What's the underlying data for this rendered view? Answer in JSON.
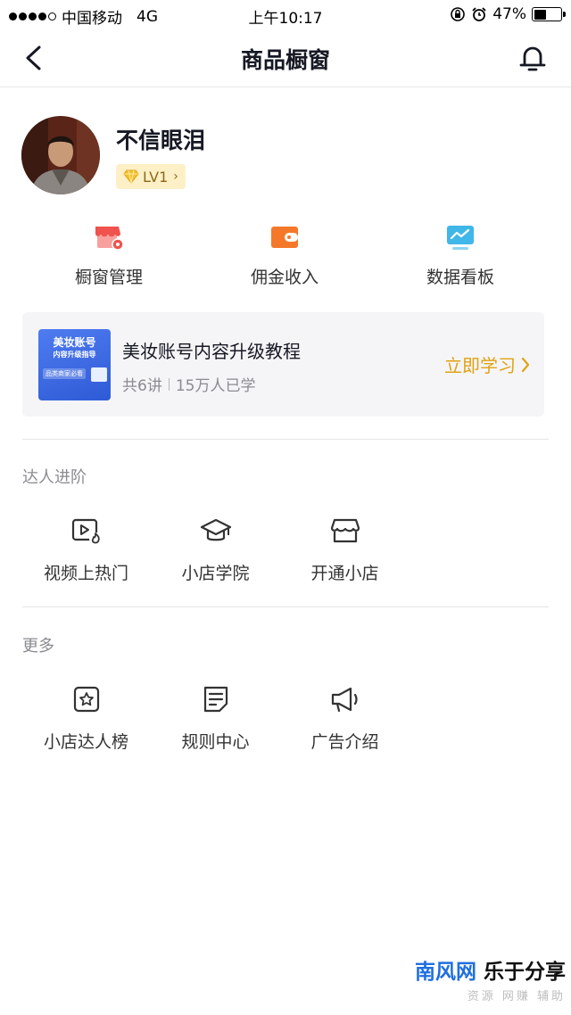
{
  "status_bar": {
    "carrier": "中国移动",
    "network": "4G",
    "time": "上午10:17",
    "battery": "47%",
    "battery_level": 0.47
  },
  "nav": {
    "title": "商品橱窗"
  },
  "profile": {
    "name": "不信眼泪",
    "level": "LV1"
  },
  "quick_actions": [
    {
      "label": "橱窗管理",
      "icon": "storefront-gear-icon",
      "color": "#f0524d"
    },
    {
      "label": "佣金收入",
      "icon": "wallet-icon",
      "color": "#f5782a"
    },
    {
      "label": "数据看板",
      "icon": "dashboard-screen-icon",
      "color": "#3fb7e8"
    }
  ],
  "course": {
    "thumb_title": "美妆账号",
    "thumb_subtitle": "内容升级指导",
    "thumb_tag": "品类商家必看",
    "title": "美妆账号内容升级教程",
    "lessons": "共6讲",
    "learners": "15万人已学",
    "cta": "立即学习"
  },
  "sections": [
    {
      "title": "达人进阶",
      "items": [
        {
          "label": "视频上热门",
          "icon": "video-hot-icon"
        },
        {
          "label": "小店学院",
          "icon": "graduation-cap-icon"
        },
        {
          "label": "开通小店",
          "icon": "shop-icon"
        }
      ]
    },
    {
      "title": "更多",
      "items": [
        {
          "label": "小店达人榜",
          "icon": "star-badge-icon"
        },
        {
          "label": "规则中心",
          "icon": "document-list-icon"
        },
        {
          "label": "广告介绍",
          "icon": "megaphone-icon"
        }
      ]
    }
  ],
  "watermark": {
    "brand_blue": "南风网",
    "brand_black": "乐于分享",
    "tagline": "资源 网赚 辅助"
  },
  "colors": {
    "accent": "#e0a212",
    "level_badge_bg": "#fdf0c6",
    "card_bg": "#f5f5f7"
  }
}
